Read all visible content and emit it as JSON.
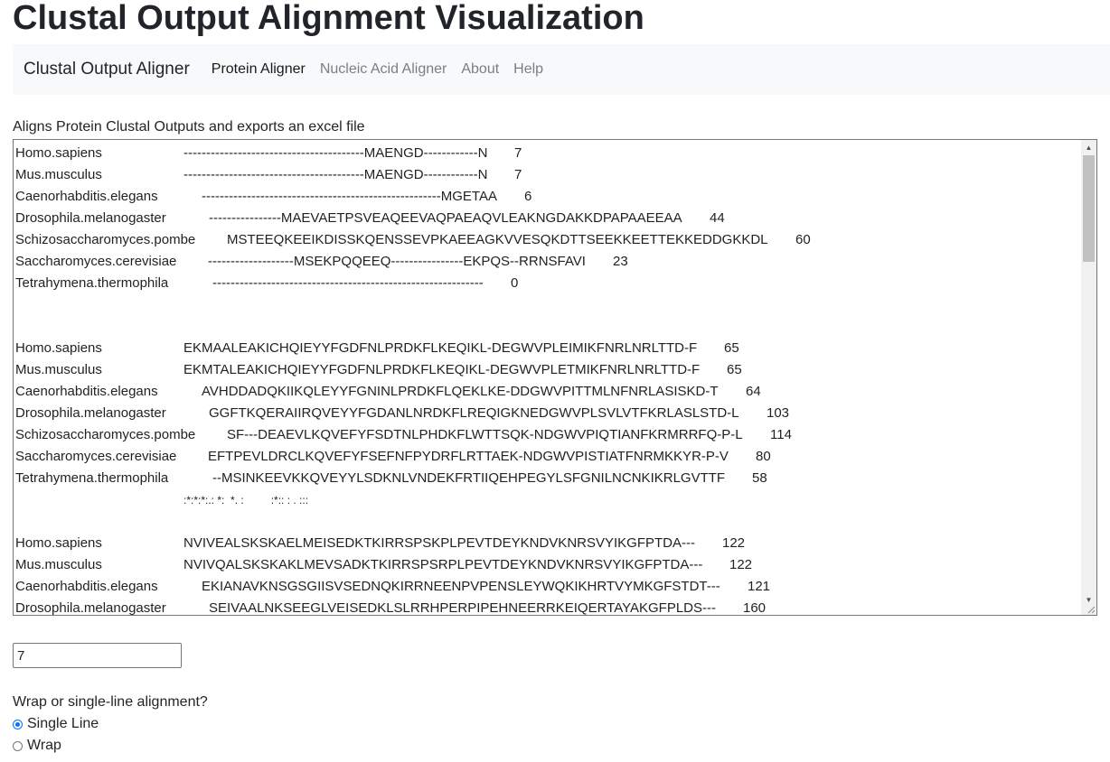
{
  "page": {
    "title": "Clustal Output Alignment Visualization"
  },
  "navbar": {
    "brand": "Clustal Output Aligner",
    "items": [
      {
        "label": "Protein Aligner",
        "active": true
      },
      {
        "label": "Nucleic Acid Aligner",
        "active": false
      },
      {
        "label": "About",
        "active": false
      },
      {
        "label": "Help",
        "active": false
      }
    ]
  },
  "description": "Aligns Protein Clustal Outputs and exports an excel file",
  "alignment": {
    "blocks": [
      {
        "rows": [
          {
            "name": "Homo.sapiens",
            "seq": "----------------------------------------MAENGD------------N",
            "count": "7"
          },
          {
            "name": "Mus.musculus",
            "seq": "----------------------------------------MAENGD------------N",
            "count": "7"
          },
          {
            "name": "Caenorhabditis.elegans",
            "seq": "-----------------------------------------------------MGETAA",
            "count": "6"
          },
          {
            "name": "Drosophila.melanogaster",
            "seq": "----------------MAEVAETPSVEAQEEVAQPAEAQVLEAKNGDAKKDPAPAAEEAA",
            "count": "44"
          },
          {
            "name": "Schizosaccharomyces.pombe",
            "seq": "MSTEEQKEEIKDISSKQENSSEVPKAEEAGKVVESQKDTTSEEKKEETTEKKEDDGKKDL",
            "count": "60"
          },
          {
            "name": "Saccharomyces.cerevisiae",
            "seq": "-------------------MSEKPQQEEQ----------------EKPQS--RRNSFAVI",
            "count": "23"
          },
          {
            "name": "Tetrahymena.thermophila",
            "seq": "------------------------------------------------------------",
            "count": "0"
          }
        ],
        "consensus": ""
      },
      {
        "rows": [
          {
            "name": "Homo.sapiens",
            "seq": "EKMAALEAKICHQIEYYFGDFNLPRDKFLKEQIKL-DEGWVPLEIMIKFNRLNRLTTD-F",
            "count": "65"
          },
          {
            "name": "Mus.musculus",
            "seq": "EKMTALEAKICHQIEYYFGDFNLPRDKFLKEQIKL-DEGWVPLETMIKFNRLNRLTTD-F",
            "count": "65"
          },
          {
            "name": "Caenorhabditis.elegans",
            "seq": "AVHDDADQKIIKQLEYYFGNINLPRDKFLQEKLKE-DDGWVPITTMLNFNRLASISKD-T",
            "count": "64"
          },
          {
            "name": "Drosophila.melanogaster",
            "seq": "GGFTKQERAIIRQVEYYFGDANLNRDKFLREQIGKNEDGWVPLSVLVTFKRLASLSTD-L",
            "count": "103"
          },
          {
            "name": "Schizosaccharomyces.pombe",
            "seq": "SF---DEAEVLKQVEFYFSDTNLPHDKFLWTTSQK-NDGWVPIQTIANFKRMRRFQ-P-L",
            "count": "114"
          },
          {
            "name": "Saccharomyces.cerevisiae",
            "seq": "EFTPEVLDRCLKQVEFYFSEFNFPYDRFLRTTAEK-NDGWVPISTIATFNRMKKYR-P-V",
            "count": "80"
          },
          {
            "name": "Tetrahymena.thermophila",
            "seq": "--MSINKEEVKKQVEYYLSDKNLVNDEKFRTIIQEHPEGYLSFGNILNCNKIKRLGVTTF",
            "count": "58"
          }
        ],
        "consensus": ":*:*:*:.: *:  *. :         :*:: : . :::"
      },
      {
        "rows": [
          {
            "name": "Homo.sapiens",
            "seq": "NVIVEALSKSKAELMEISEDKTKIRRSPSKPLPEVTDEYKNDVKNRSVYIKGFPTDA---",
            "count": "122"
          },
          {
            "name": "Mus.musculus",
            "seq": "NVIVQALSKSKAKLMEVSADKTKIRRSPSRPLPEVTDEYKNDVKNRSVYIKGFPTDA---",
            "count": "122"
          },
          {
            "name": "Caenorhabditis.elegans",
            "seq": "EKIANAVKNSGSGIISVSEDNQKIRRNEENPVPENSLEYWQKIKHRTVYMKGFSTDT---",
            "count": "121"
          },
          {
            "name": "Drosophila.melanogaster",
            "seq": "SEIVAALNKSEEGLVEISEDKLSLRRHPERPIPEHNEERRKEIQERTAYAKGFPLDS---",
            "count": "160"
          }
        ]
      }
    ]
  },
  "input": {
    "value": "7"
  },
  "wrap_option": {
    "question": "Wrap or single-line alignment?",
    "options": [
      {
        "label": "Single Line",
        "checked": true
      },
      {
        "label": "Wrap",
        "checked": false
      }
    ]
  }
}
